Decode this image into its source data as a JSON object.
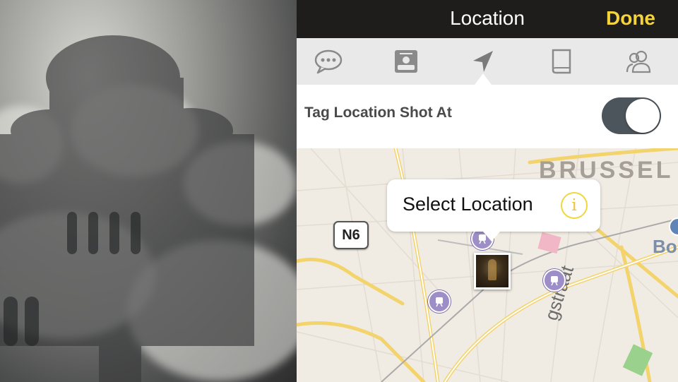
{
  "nav": {
    "title": "Location",
    "done_label": "Done"
  },
  "tabs": [
    {
      "name": "comments",
      "icon": "speech-bubble-icon"
    },
    {
      "name": "portrait",
      "icon": "photo-frame-icon"
    },
    {
      "name": "location",
      "icon": "location-arrow-icon",
      "selected": true
    },
    {
      "name": "notes",
      "icon": "book-icon"
    },
    {
      "name": "people",
      "icon": "people-icon"
    }
  ],
  "tag_location": {
    "label": "Tag Location Shot At",
    "enabled": true
  },
  "map": {
    "callout_text": "Select Location",
    "info_icon": "i",
    "road_shield": "N6",
    "city_label": "BRUSSEL",
    "city_label_2": "Bo",
    "street_label": "gstraat"
  },
  "colors": {
    "accent": "#f5d33b",
    "navbar": "#1e1d1b",
    "toggle_on": "#4c555b",
    "transit": "#9d8ec7"
  }
}
